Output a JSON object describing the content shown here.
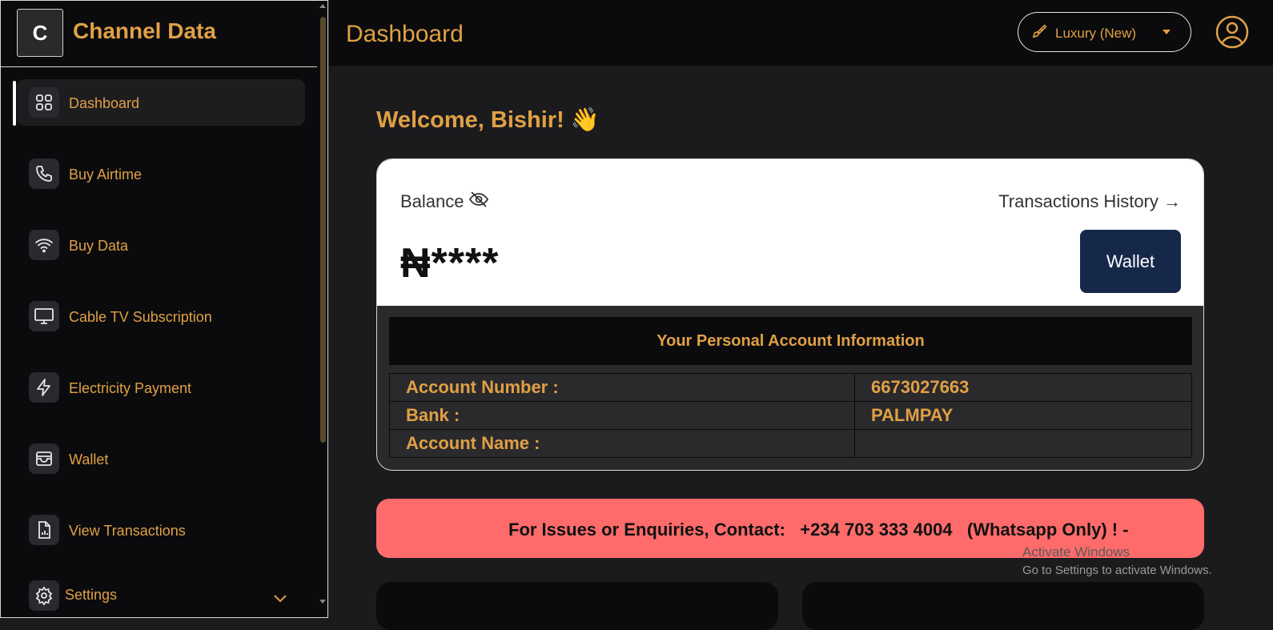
{
  "brand": {
    "logo_letter": "C",
    "name": "Channel Data"
  },
  "sidebar": {
    "items": [
      {
        "label": "Dashboard",
        "icon": "grid-icon",
        "active": true
      },
      {
        "label": "Buy Airtime",
        "icon": "phone-icon"
      },
      {
        "label": "Buy Data",
        "icon": "wifi-icon"
      },
      {
        "label": "Cable TV Subscription",
        "icon": "monitor-icon"
      },
      {
        "label": "Electricity Payment",
        "icon": "lightning-icon"
      },
      {
        "label": "Wallet",
        "icon": "wallet-icon"
      },
      {
        "label": "View Transactions",
        "icon": "document-chart-icon"
      },
      {
        "label": "Settings",
        "icon": "gear-icon"
      }
    ]
  },
  "header": {
    "title": "Dashboard",
    "theme_select": {
      "value": "Luxury (New)",
      "icon": "paint-brush-icon"
    },
    "avatar_icon": "user-circle-icon"
  },
  "main": {
    "welcome": "Welcome, Bishir! 👋",
    "balance": {
      "label": "Balance",
      "value": "₦****",
      "history_link": "Transactions History →",
      "wallet_button": "Wallet"
    },
    "account": {
      "title": "Your Personal Account Information",
      "rows": [
        {
          "key": "Account Number :",
          "value": "6673027663"
        },
        {
          "key": "Bank :",
          "value": "PALMPAY"
        },
        {
          "key": "Account Name :",
          "value": ""
        }
      ]
    },
    "contact": "For Issues or Enquiries, Contact:   +234 703 333 4004   (Whatsapp Only) ! -"
  },
  "os_watermark": {
    "line1": "Activate Windows",
    "line2": "Go to Settings to activate Windows."
  },
  "colors": {
    "accent": "#e0a045",
    "sidebar_bg": "#0b0b0d",
    "main_bg": "#1b1b1d",
    "wallet_button": "#16284a",
    "contact_bar": "#ff6b6b"
  }
}
